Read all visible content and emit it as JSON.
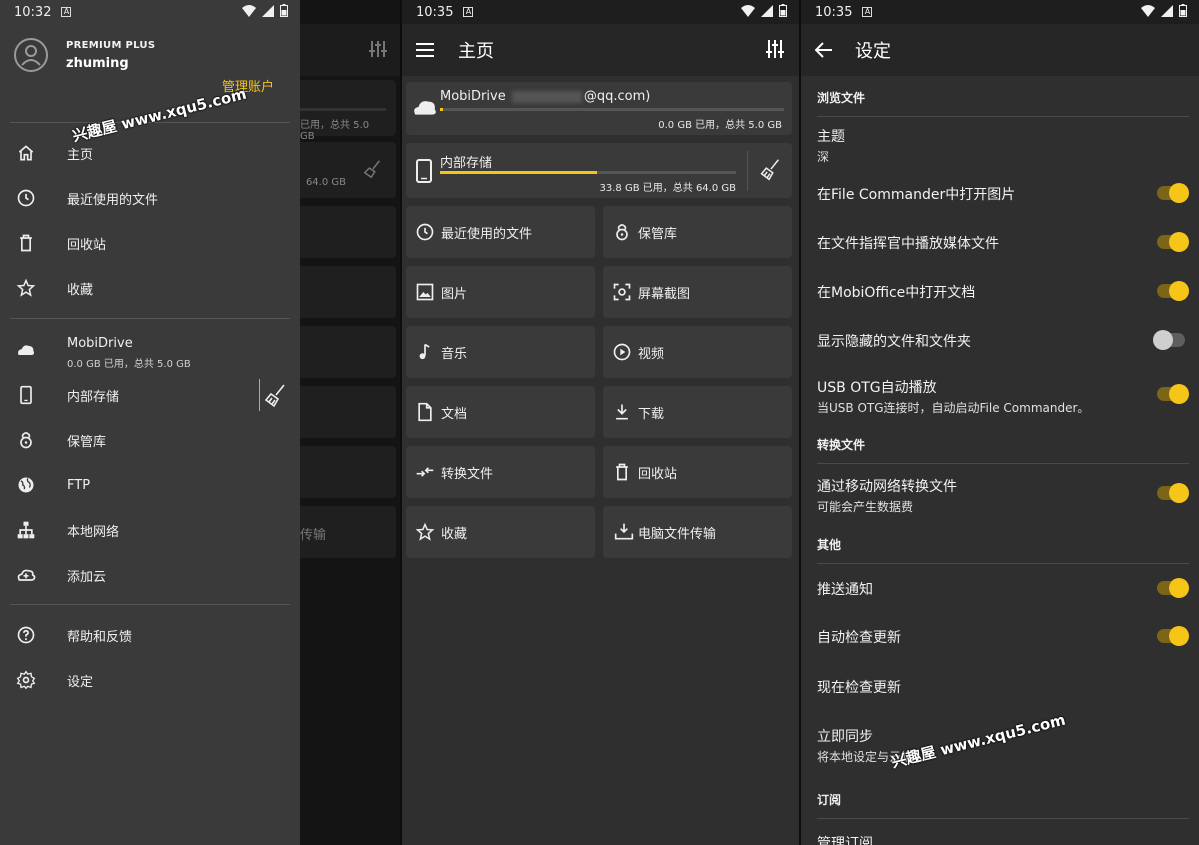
{
  "status": {
    "time1": "10:32",
    "time2": "10:35",
    "time3": "10:35",
    "a_label": "A"
  },
  "drawer": {
    "plan": "PREMIUM PLUS",
    "user": "zhuming",
    "manage": "管理账户",
    "items": [
      {
        "label": "主页",
        "icon": "home-icon"
      },
      {
        "label": "最近使用的文件",
        "icon": "clock-icon"
      },
      {
        "label": "回收站",
        "icon": "trash-icon"
      },
      {
        "label": "收藏",
        "icon": "star-icon"
      },
      {
        "label": "MobiDrive",
        "sub": "0.0 GB 已用，总共 5.0 GB",
        "icon": "cloud-icon"
      },
      {
        "label": "内部存储",
        "icon": "phone-icon"
      },
      {
        "label": "保管库",
        "icon": "vault-icon"
      },
      {
        "label": "FTP",
        "icon": "globe-icon"
      },
      {
        "label": "本地网络",
        "icon": "network-icon"
      },
      {
        "label": "添加云",
        "icon": "cloud-add-icon"
      },
      {
        "label": "帮助和反馈",
        "icon": "help-icon"
      },
      {
        "label": "设定",
        "icon": "settings-icon"
      }
    ],
    "bg_usage1": "已用，总共 5.0 GB",
    "bg_usage2": "64.0 GB",
    "bg_text": "传输"
  },
  "home": {
    "title": "主页",
    "mobidrive": {
      "name": "MobiDrive",
      "email_suffix": "@qq.com)",
      "usage": "0.0 GB 已用，总共 5.0 GB",
      "fill": 0.01
    },
    "internal": {
      "name": "内部存储",
      "usage": "33.8 GB 已用，总共 64.0 GB",
      "fill": 0.53
    },
    "tiles": [
      {
        "label": "最近使用的文件",
        "icon": "clock-icon"
      },
      {
        "label": "保管库",
        "icon": "vault-icon"
      },
      {
        "label": "图片",
        "icon": "image-icon"
      },
      {
        "label": "屏幕截图",
        "icon": "screenshot-icon"
      },
      {
        "label": "音乐",
        "icon": "music-icon"
      },
      {
        "label": "视频",
        "icon": "video-icon"
      },
      {
        "label": "文档",
        "icon": "document-icon"
      },
      {
        "label": "下载",
        "icon": "download-icon"
      },
      {
        "label": "转换文件",
        "icon": "transfer-icon"
      },
      {
        "label": "回收站",
        "icon": "trash-icon"
      },
      {
        "label": "收藏",
        "icon": "star-icon"
      },
      {
        "label": "电脑文件传输",
        "icon": "pc-transfer-icon"
      }
    ]
  },
  "settings": {
    "title": "设定",
    "sections": {
      "browse": "浏览文件",
      "transfer": "转换文件",
      "other": "其他",
      "subscription": "订阅"
    },
    "theme": {
      "title": "主题",
      "value": "深"
    },
    "rows": [
      {
        "title": "在File Commander中打开图片",
        "on": true
      },
      {
        "title": "在文件指挥官中播放媒体文件",
        "on": true
      },
      {
        "title": "在MobiOffice中打开文档",
        "on": true
      },
      {
        "title": "显示隐藏的文件和文件夹",
        "on": false
      },
      {
        "title": "USB OTG自动播放",
        "sub": "当USB OTG连接时，自动启动File Commander。",
        "on": true
      }
    ],
    "mobile": {
      "title": "通过移动网络转换文件",
      "sub": "可能会产生数据费",
      "on": true
    },
    "push": {
      "title": "推送通知",
      "on": true
    },
    "auto_update": {
      "title": "自动检查更新",
      "on": true
    },
    "check_now": "现在检查更新",
    "sync": {
      "title": "立即同步",
      "sub": "将本地设定与云端"
    },
    "manage_sub": "管理订阅"
  },
  "watermark": "兴趣屋 www.xqu5.com",
  "colors": {
    "accent": "#f5c518"
  }
}
